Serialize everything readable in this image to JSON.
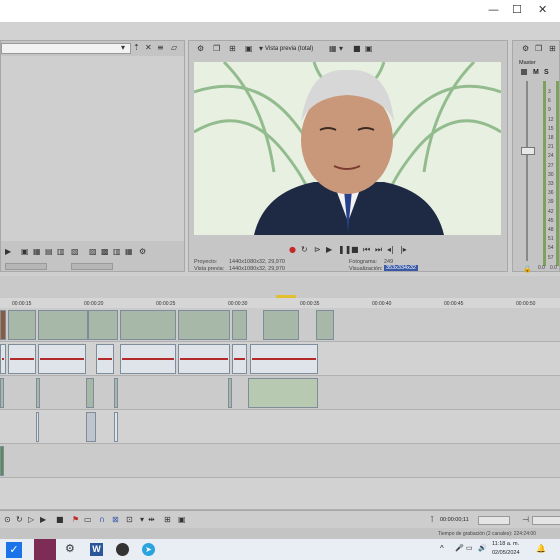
{
  "window": {
    "minimize_glyph": "—",
    "maximize_glyph": "☐",
    "close_glyph": "✕"
  },
  "preview": {
    "mode_label": "Vista previa (total)",
    "proyecto_label": "Proyecto:",
    "proyecto_value": "1440x1080x32, 29,970",
    "vista_previa_label": "Vista previa:",
    "vista_previa_value": "1440x1080x32, 29,970",
    "fotograma_label": "Fotograma:",
    "fotograma_value": "249",
    "visualizacion_label": "Visualización:",
    "visualizacion_value": "353x334x32"
  },
  "master": {
    "label": "Master",
    "m_label": "M",
    "s_label": "S",
    "scale": [
      "3",
      "6",
      "9",
      "12",
      "15",
      "18",
      "21",
      "24",
      "27",
      "30",
      "33",
      "36",
      "39",
      "42",
      "45",
      "48",
      "51",
      "54",
      "57"
    ],
    "level_left": "0.0",
    "level_right": "0.0"
  },
  "timeline": {
    "ruler": [
      "00:00:15",
      "00:00:20",
      "00:00:25",
      "00:00:30",
      "00:00:35",
      "00:00:40",
      "00:00:45",
      "00:00:50"
    ]
  },
  "status": {
    "timecode": "00:00:00;11",
    "record_time": "Tiempo de grabación (2 canales): 224:24:00"
  },
  "taskbar": {
    "time": "11:18 a. m.",
    "date": "02/05/2024",
    "lang": "ESP",
    "chevron": "^"
  },
  "icons": {
    "play": "▶",
    "stop": "■",
    "pause": "❚❚",
    "record": "●",
    "loop": "↻",
    "prev": "⏮",
    "next": "⏭",
    "gear": "⚙",
    "bell": "🔔"
  },
  "colors": {
    "accent": "#3b5aa6",
    "waveform": "#b22a2a",
    "record": "#c62828"
  }
}
